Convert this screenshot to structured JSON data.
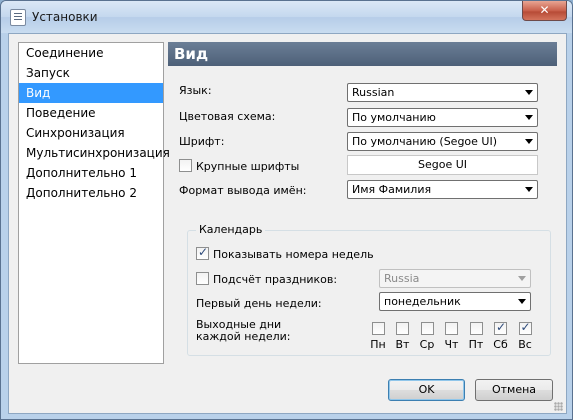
{
  "window": {
    "title": "Установки",
    "close_label": "✕"
  },
  "sidebar": {
    "items": [
      {
        "label": "Соединение"
      },
      {
        "label": "Запуск"
      },
      {
        "label": "Вид",
        "selected": true
      },
      {
        "label": "Поведение"
      },
      {
        "label": "Синхронизация"
      },
      {
        "label": "Мультисинхронизация"
      },
      {
        "label": "Дополнительно 1"
      },
      {
        "label": "Дополнительно 2"
      }
    ]
  },
  "panel": {
    "title": "Вид",
    "language_label": "Язык:",
    "language_value": "Russian",
    "color_scheme_label": "Цветовая схема:",
    "color_scheme_value": "По умолчанию",
    "font_label": "Шрифт:",
    "font_value": "По умолчанию (Segoe UI)",
    "large_fonts_label": "Крупные шрифты",
    "large_fonts_checked": false,
    "font_preview": "Segoe UI",
    "name_format_label": "Формат вывода имён:",
    "name_format_value": "Имя Фамилия"
  },
  "calendar": {
    "title": "Календарь",
    "week_numbers_label": "Показывать номера недель",
    "week_numbers_checked": true,
    "holidays_label": "Подсчёт праздников:",
    "holidays_checked": false,
    "holidays_country": "Russia",
    "first_day_label": "Первый день недели:",
    "first_day_value": "понедельник",
    "weekend_label_line1": "Выходные дни",
    "weekend_label_line2": "каждой недели:",
    "days": [
      {
        "label": "Пн",
        "checked": false
      },
      {
        "label": "Вт",
        "checked": false
      },
      {
        "label": "Ср",
        "checked": false
      },
      {
        "label": "Чт",
        "checked": false
      },
      {
        "label": "Пт",
        "checked": false
      },
      {
        "label": "Сб",
        "checked": true
      },
      {
        "label": "Вс",
        "checked": true
      }
    ]
  },
  "buttons": {
    "ok": "OK",
    "cancel": "Отмена"
  }
}
